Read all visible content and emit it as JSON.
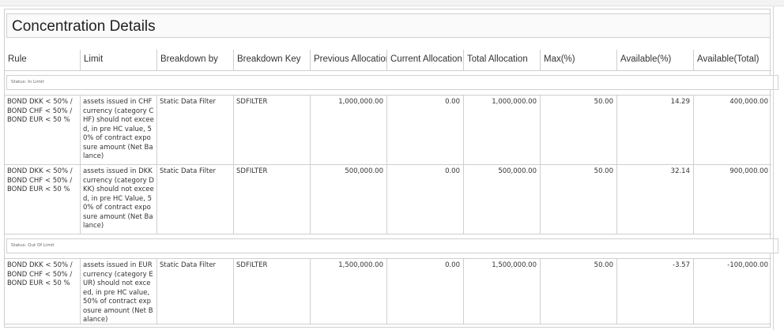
{
  "page": {
    "title": "Concentration Details"
  },
  "columns": [
    "Rule",
    "Limit",
    "Breakdown by",
    "Breakdown Key",
    "Previous Allocation",
    "Current Allocation",
    "Total Allocation",
    "Max(%)",
    "Available(%)",
    "Available(Total)"
  ],
  "groups": [
    {
      "status": "Status: In Limit",
      "rows": [
        {
          "rule": "BOND DKK < 50% / BOND CHF < 50% / BOND EUR < 50 %",
          "limit": "assets issued in CHF currency (category CHF) should not exceed, in pre HC value, 50% of contract exposure amount (Net Balance)",
          "breakdown_by": "Static Data Filter",
          "breakdown_key": "SDFILTER",
          "previous_allocation": "1,000,000.00",
          "current_allocation": "0.00",
          "total_allocation": "1,000,000.00",
          "max_pct": "50.00",
          "available_pct": "14.29",
          "available_total": "400,000.00"
        },
        {
          "rule": "BOND DKK < 50% / BOND CHF < 50% / BOND EUR < 50 %",
          "limit": "assets issued in DKK currency (category DKK) should not exceed, in pre HC Value, 50% of contract exposure amount (Net Balance)",
          "breakdown_by": "Static Data Filter",
          "breakdown_key": "SDFILTER",
          "previous_allocation": "500,000.00",
          "current_allocation": "0.00",
          "total_allocation": "500,000.00",
          "max_pct": "50.00",
          "available_pct": "32.14",
          "available_total": "900,000.00"
        }
      ]
    },
    {
      "status": "Status: Out Of Limit",
      "rows": [
        {
          "rule": "BOND DKK < 50% / BOND CHF < 50% / BOND EUR < 50 %",
          "limit": "assets issued in EUR currency (category EUR) should not exceed, in pre HC value, 50% of contract exposure amount (Net Balance)",
          "breakdown_by": "Static Data Filter",
          "breakdown_key": "SDFILTER",
          "previous_allocation": "1,500,000.00",
          "current_allocation": "0.00",
          "total_allocation": "1,500,000.00",
          "max_pct": "50.00",
          "available_pct": "-3.57",
          "available_total": "-100,000.00"
        }
      ]
    }
  ]
}
